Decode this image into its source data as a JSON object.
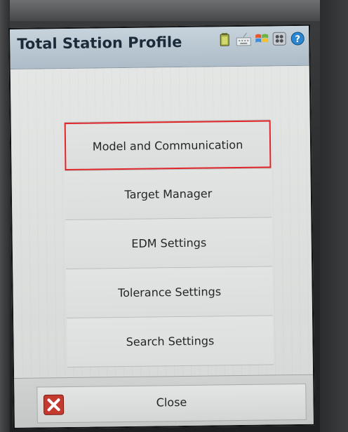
{
  "window": {
    "title": "Total Station Profile"
  },
  "status_icons": [
    {
      "name": "battery-icon"
    },
    {
      "name": "keyboard-icon"
    },
    {
      "name": "windows-start-icon"
    },
    {
      "name": "grid-menu-icon"
    },
    {
      "name": "help-icon"
    }
  ],
  "menu": {
    "items": [
      {
        "label": "Model and Communication",
        "highlighted": true
      },
      {
        "label": "Target Manager"
      },
      {
        "label": "EDM Settings"
      },
      {
        "label": "Tolerance Settings"
      },
      {
        "label": "Search Settings"
      }
    ]
  },
  "toolbar": {
    "close_label": "Close"
  },
  "colors": {
    "highlight": "#e0262a",
    "titlebar": "#b9c7d2",
    "close_icon": "#c43a2e",
    "help_icon": "#2a86d0"
  }
}
